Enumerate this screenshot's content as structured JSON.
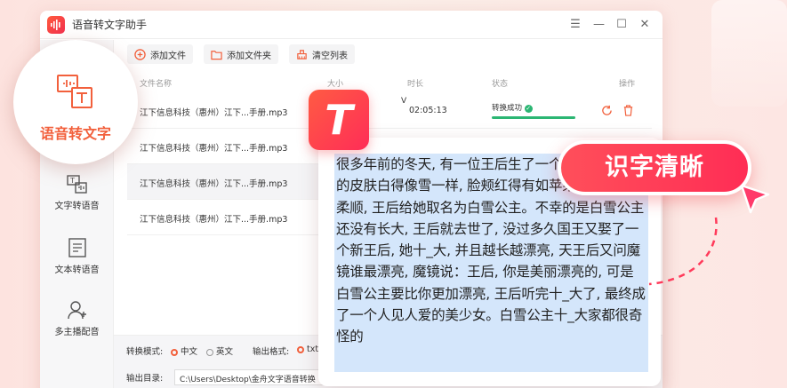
{
  "app": {
    "title": "语音转文字助手"
  },
  "window_controls": [
    "☰",
    "—",
    "☐",
    "✕"
  ],
  "sidebar": {
    "featured": "语音转文字",
    "items": [
      {
        "label": "文字转语音",
        "icon": "text-to-speech-icon"
      },
      {
        "label": "文本转语音",
        "icon": "document-icon"
      },
      {
        "label": "多主播配音",
        "icon": "user-plus-icon"
      }
    ]
  },
  "toolbar": {
    "add_file": "添加文件",
    "add_folder": "添加文件夹",
    "clear_list": "清空列表"
  },
  "table": {
    "headers": {
      "name": "文件名称",
      "size": "大小",
      "duration": "时长",
      "status": "状态",
      "actions": "操作"
    },
    "rows": [
      {
        "name": "江下信息科技（惠州）江下...手册.mp3",
        "duration": "02:05:13",
        "status": "转换成功",
        "size_prefix": "V"
      },
      {
        "name": "江下信息科技（惠州）江下...手册.mp3"
      },
      {
        "name": "江下信息科技（惠州）江下...手册.mp3"
      },
      {
        "name": "江下信息科技（惠州）江下...手册.mp3"
      }
    ]
  },
  "bottom": {
    "mode_label": "转换模式:",
    "mode_zh": "中文",
    "mode_en": "英文",
    "format_label": "输出格式:",
    "format_txt": "txt",
    "dir_label": "输出目录:",
    "dir_value": "C:\\Users\\Desktop\\金舟文字语音转换"
  },
  "logo_letter": "T",
  "story": "很多年前的冬天, 有一位王后生了一个女孩, 个女孩的皮肤白得像雪一样, 脸颊红得有如苹果, 头发乌黑柔顺, 王后给她取名为白雪公主。不幸的是白雪公主还没有长大, 王后就去世了, 没过多久国王又娶了一个新王后, 她十_大, 并且越长越漂亮, 天王后又问魔镜谁最漂亮, 魔镜说：王后, 你是美丽漂亮的, 可是白雪公主要比你更加漂亮, 王后听完十_大了, 最终成了一个人见人爱的美少女。白雪公主十_大家都很奇怪的",
  "badge": "识字清晰",
  "colors": {
    "accent": "#f2603c",
    "brand": "#ff2d55",
    "success": "#2bb673"
  }
}
